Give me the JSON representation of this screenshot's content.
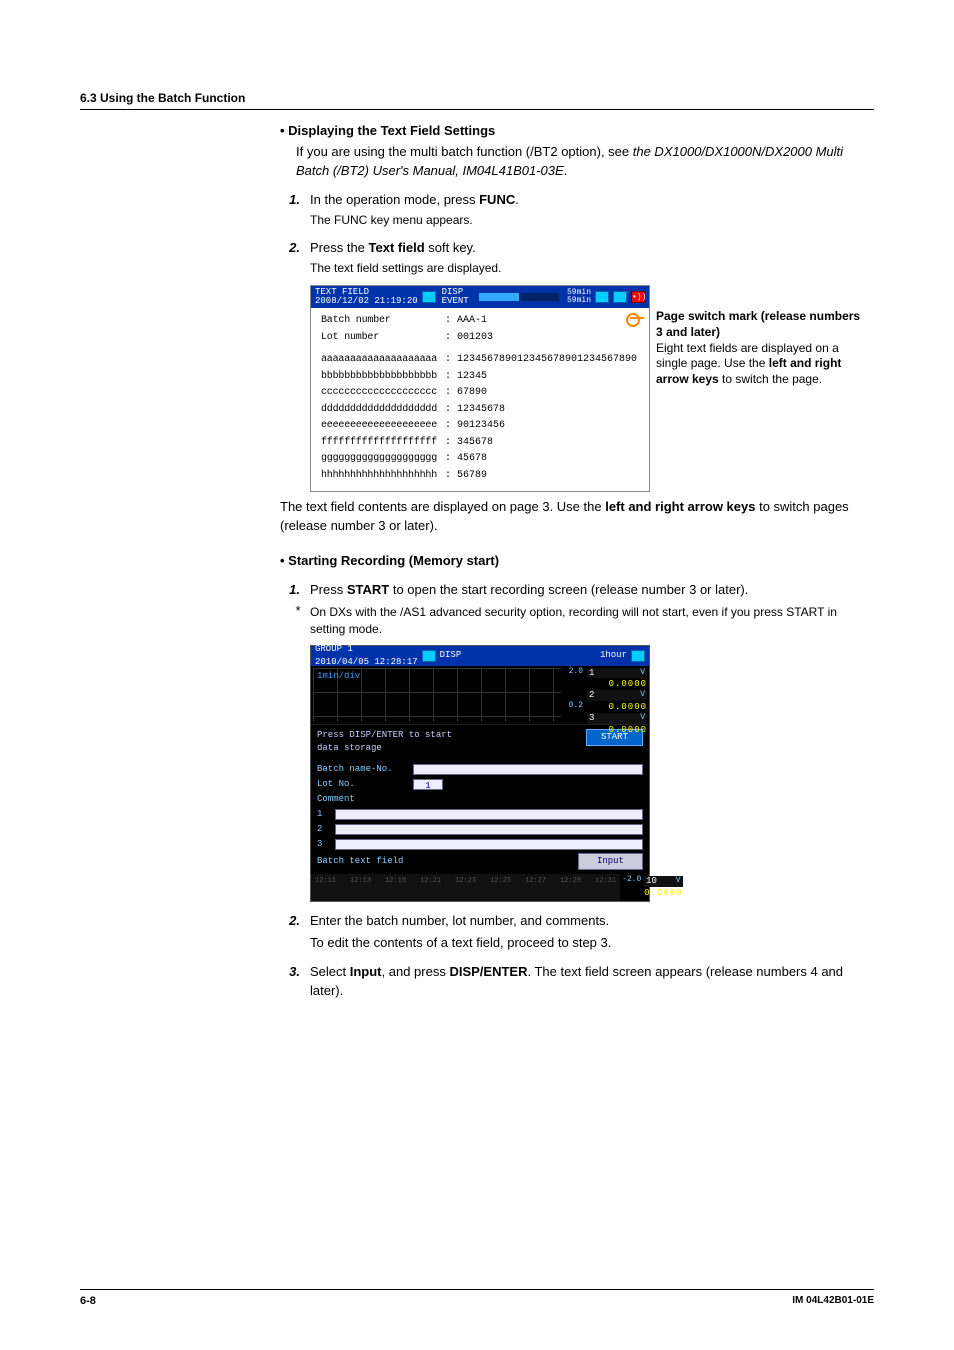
{
  "header": {
    "section": "6.3  Using the Batch Function"
  },
  "disp_text": {
    "title": "Displaying the Text Field Settings",
    "body_1": "If you are using the multi batch function (/BT2 option), see ",
    "body_em": "the DX1000/DX1000N/DX2000 Multi Batch (/BT2) User's Manual, IM04L41B01-03E",
    "body_2": "."
  },
  "steps_a": {
    "s1_num": "1.",
    "s1_a": "In the operation mode, press ",
    "s1_b": "FUNC",
    "s1_c": ".",
    "s1_sub": "The FUNC key menu appears.",
    "s2_num": "2.",
    "s2_a": "Press the ",
    "s2_b": "Text field",
    "s2_c": " soft key.",
    "s2_sub": "The text field settings are displayed."
  },
  "shot1": {
    "title1": "TEXT FIELD",
    "title2": "2008/12/02 21:19:20",
    "disp": "DISP",
    "event": "EVENT",
    "min1": "59min",
    "min2": "59min",
    "rows": [
      {
        "l": "Batch number",
        "v": ": AAA-1"
      },
      {
        "l": "Lot number",
        "v": ": 001203"
      },
      {
        "l": "aaaaaaaaaaaaaaaaaaaa",
        "v": ": 123456789012345678901234567890"
      },
      {
        "l": "bbbbbbbbbbbbbbbbbbbb",
        "v": ": 12345"
      },
      {
        "l": "cccccccccccccccccccc",
        "v": ": 67890"
      },
      {
        "l": "dddddddddddddddddddd",
        "v": ": 12345678"
      },
      {
        "l": "eeeeeeeeeeeeeeeeeeee",
        "v": ": 90123456"
      },
      {
        "l": "ffffffffffffffffffff",
        "v": ": 345678"
      },
      {
        "l": "gggggggggggggggggggg",
        "v": ": 45678"
      },
      {
        "l": "hhhhhhhhhhhhhhhhhhhh",
        "v": ": 56789"
      }
    ]
  },
  "annot1": {
    "l1": "Page switch mark (release numbers 3 and later)",
    "l2": "Eight text fields are displayed on a single page. Use the ",
    "l2b": "left and right arrow keys",
    "l2c": " to switch the page."
  },
  "after_shot1": {
    "a": "The text field contents are displayed on page 3. Use the ",
    "b": "left and right arrow keys",
    "c": " to switch pages (release number 3 or later)."
  },
  "start_rec": {
    "title": "Starting Recording (Memory start)",
    "s1_num": "1.",
    "s1_a": "Press ",
    "s1_b": "START",
    "s1_c": " to open the start recording screen (release number 3 or later).",
    "note_star": "*",
    "note": "On DXs with the /AS1 advanced security option, recording will not start, even if you press START in setting mode."
  },
  "shot2": {
    "title1": "GROUP 1",
    "title2": "2010/04/05 12:28:17",
    "disp": "DISP",
    "hour": "1hour",
    "div": "1min/div",
    "scale_top": "2.0",
    "scale_bot": "0.2",
    "sv": [
      {
        "n": "1",
        "u": "V",
        "v": "0.0000"
      },
      {
        "n": "2",
        "u": "V",
        "v": "0.0000"
      },
      {
        "n": "3",
        "u": "V",
        "v": "0.0000"
      }
    ],
    "msg1": "Press DISP/ENTER to start",
    "msg2": "data storage",
    "start": "START",
    "batch_lbl": "Batch name-No.",
    "lot_lbl": "Lot No.",
    "lot_val": "1",
    "comment": "Comment",
    "c1": "1",
    "c2": "2",
    "c3": "3",
    "btf": "Batch text field",
    "input": "Input",
    "sv10": {
      "n": "10",
      "u": "V",
      "v": "0.0000"
    },
    "ticks": [
      "12:11",
      "12:13",
      "12:15",
      "12:21",
      "12:23",
      "12:25",
      "12:27",
      "12:29",
      "12:31"
    ],
    "scale2": "-2.0"
  },
  "steps_b": {
    "s2_num": "2.",
    "s2_a": "Enter the batch number, lot number, and comments.",
    "s2_b": "To edit the contents of a text field, proceed to step 3.",
    "s3_num": "3.",
    "s3_a": "Select ",
    "s3_b": "Input",
    "s3_c": ", and press ",
    "s3_d": "DISP/ENTER",
    "s3_e": ". The text field screen appears (release numbers 4 and later)."
  },
  "footer": {
    "page": "6-8",
    "doc": "IM 04L42B01-01E"
  }
}
